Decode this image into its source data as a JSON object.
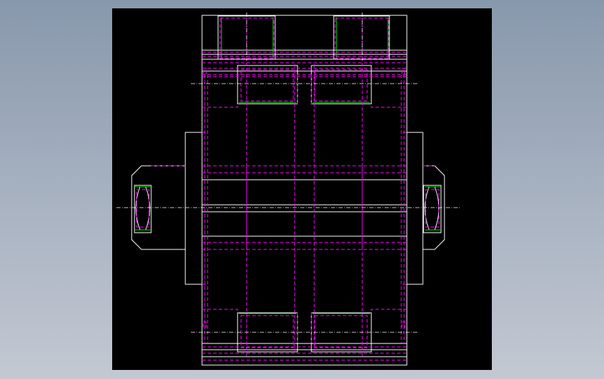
{
  "viewport": {
    "background": "#000000"
  },
  "colors": {
    "outline": "#ffffff",
    "hidden": "#ff00ff",
    "feature": "#00e000",
    "centerline": "#ffffff",
    "background_top": "#8898ac",
    "background_bottom": "#c3c8d2"
  }
}
